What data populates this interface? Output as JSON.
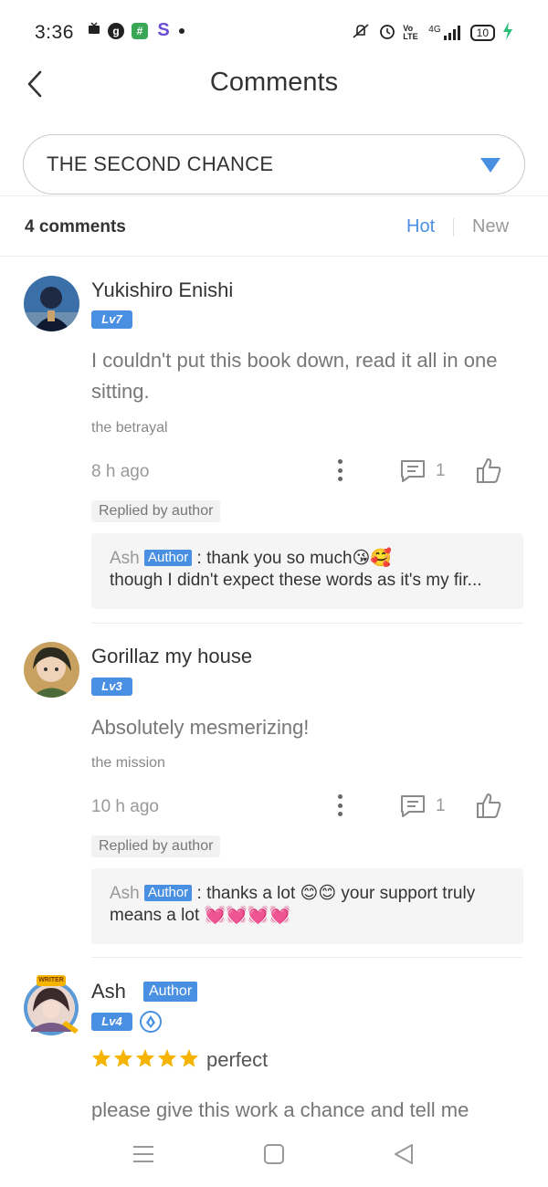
{
  "status_bar": {
    "time": "3:36",
    "lte": "Vo LTE",
    "network": "4G",
    "battery": "10"
  },
  "header": {
    "title": "Comments"
  },
  "book_selector": {
    "selected": "THE SECOND CHANCE"
  },
  "comments_bar": {
    "count_label": "4 comments",
    "sort_hot": "Hot",
    "sort_new": "New"
  },
  "comments": [
    {
      "username": "Yukishiro Enishi",
      "level": "Lv7",
      "text": "I couldn't put this book down, read it all in one sitting.",
      "chapter": "the betrayal",
      "time": "8 h ago",
      "reply_count": "1",
      "replied_tag": "Replied by author",
      "reply": {
        "name": "Ash",
        "author_tag": "Author",
        "line1": " : thank you so much😘🥰",
        "line2": "though I didn't expect these words as it's my fir..."
      }
    },
    {
      "username": "Gorillaz my house",
      "level": "Lv3",
      "text": "Absolutely mesmerizing!",
      "chapter": "the mission",
      "time": "10 h ago",
      "reply_count": "1",
      "replied_tag": "Replied by author",
      "reply": {
        "name": "Ash",
        "author_tag": "Author",
        "line1": " : thanks a lot 😊😊 your support truly",
        "line2": "means a lot 💓💓💓💓"
      }
    },
    {
      "username": "Ash",
      "author_tag": "Author",
      "avatar_frame_text": "WRITER",
      "level": "Lv4",
      "rating": 5,
      "rating_word": "perfect",
      "text": "please give this work a chance and tell me"
    }
  ],
  "colors": {
    "accent": "#4a90e2",
    "star": "#f5b400"
  }
}
